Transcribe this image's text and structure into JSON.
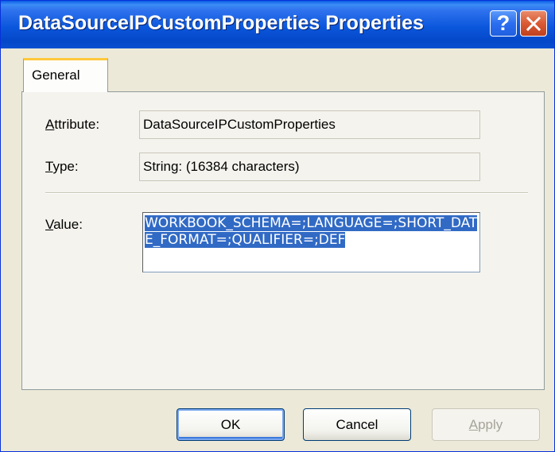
{
  "window": {
    "title": "DataSourceIPCustomProperties Properties",
    "help_glyph": "?",
    "close_icon": "close-x-icon"
  },
  "tabs": [
    {
      "label": "General",
      "selected": true
    }
  ],
  "fields": {
    "attribute": {
      "label_prefix": "",
      "label_mnemonic": "A",
      "label_rest": "ttribute:",
      "value": "DataSourceIPCustomProperties"
    },
    "type": {
      "label_prefix": "",
      "label_mnemonic": "T",
      "label_rest": "ype:",
      "value": "String: (16384 characters)"
    },
    "value": {
      "label_prefix": "",
      "label_mnemonic": "V",
      "label_rest": "alue:",
      "text": "WORKBOOK_SCHEMA=;LANGUAGE=;SHORT_DATE_FORMAT=;QUALIFIER=;DEF"
    }
  },
  "buttons": {
    "ok": "OK",
    "cancel": "Cancel",
    "apply_mnemonic": "A",
    "apply_rest": "pply",
    "apply_enabled": false
  },
  "colors": {
    "titlebar": "#0b57dc",
    "selection": "#316ac5",
    "tab_highlight": "#ffc83c"
  }
}
